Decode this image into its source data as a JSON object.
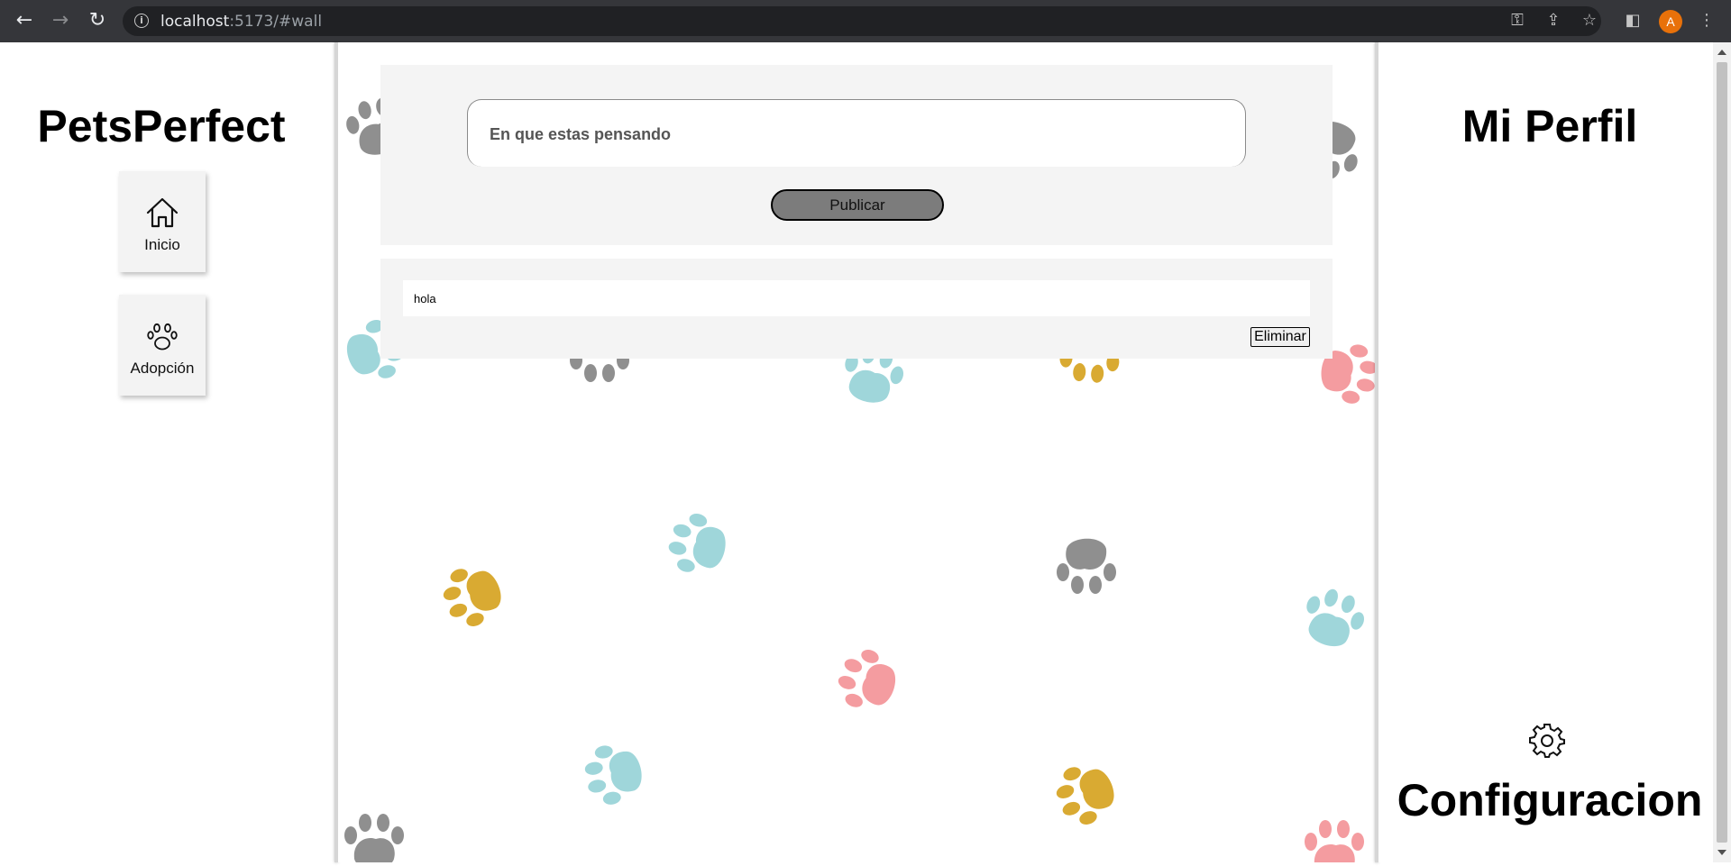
{
  "browser": {
    "url_host": "localhost",
    "url_rest": ":5173/#wall"
  },
  "left": {
    "brand": "PetsPerfect",
    "nav": [
      {
        "label": "Inicio",
        "icon": "home-icon"
      },
      {
        "label": "Adopción",
        "icon": "paw-icon"
      }
    ]
  },
  "composer": {
    "placeholder": "En que estas pensando",
    "publish_label": "Publicar"
  },
  "posts": [
    {
      "text": "hola",
      "delete_label": "Eliminar"
    }
  ],
  "right": {
    "profile_title": "Mi Perfil",
    "settings_label": "Configuracion",
    "settings_icon": "gear-icon"
  },
  "colors": {
    "paw_gray": "#8f8f8f",
    "paw_teal": "#9fd6da",
    "paw_gold": "#d9aa32",
    "paw_pink": "#f49ca0",
    "button_fill": "#7c7c7c",
    "card_bg": "#f4f4f4"
  }
}
